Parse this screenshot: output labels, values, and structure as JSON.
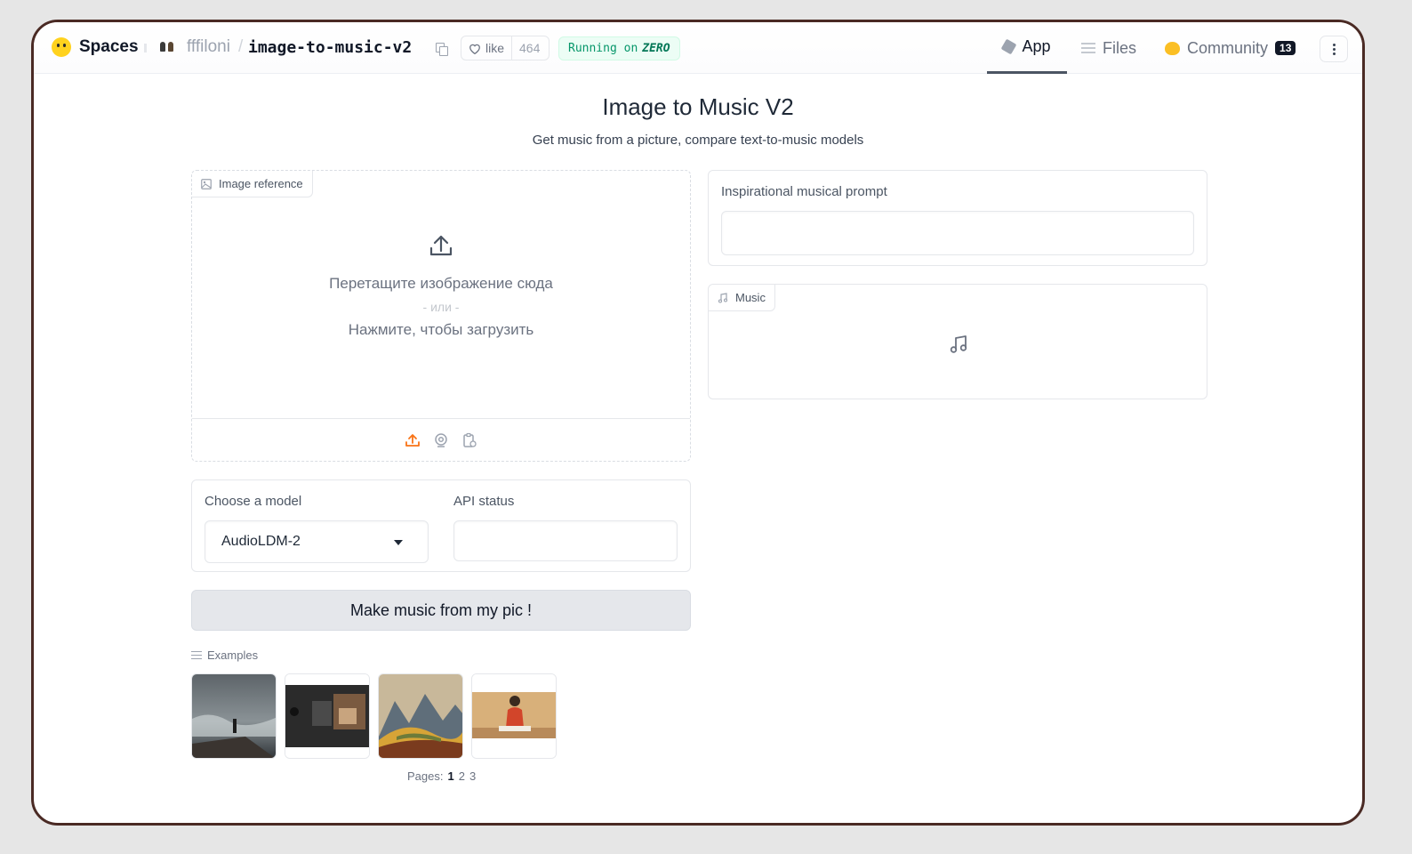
{
  "header": {
    "spaces_label": "Spaces",
    "owner": "fffiloni",
    "repo": "image-to-music-v2",
    "like_label": "like",
    "like_count": "464",
    "running_prefix": "Running on",
    "running_hw": "ZERO",
    "tabs": [
      {
        "label": "App",
        "icon": "cube-icon",
        "active": true
      },
      {
        "label": "Files",
        "icon": "files-icon",
        "active": false
      },
      {
        "label": "Community",
        "icon": "community-icon",
        "active": false,
        "badge": "13"
      }
    ]
  },
  "app": {
    "title": "Image to Music V2",
    "subtitle": "Get music from a picture, compare text-to-music models"
  },
  "image_input": {
    "label": "Image reference",
    "drop_text": "Перетащите изображение сюда",
    "or_text": "- или -",
    "click_text": "Нажмите, чтобы загрузить",
    "sources": [
      "upload-icon",
      "webcam-icon",
      "clipboard-icon"
    ]
  },
  "prompt_output": {
    "label": "Inspirational musical prompt",
    "value": ""
  },
  "music_output": {
    "label": "Music"
  },
  "model_select": {
    "label": "Choose a model",
    "value": "AudioLDM-2"
  },
  "api_status": {
    "label": "API status",
    "value": ""
  },
  "submit_button": {
    "label": "Make music from my pic !"
  },
  "examples": {
    "label": "Examples",
    "items": [
      {
        "name": "stormy-sea-cliff"
      },
      {
        "name": "vintage-car-interior"
      },
      {
        "name": "painted-hills"
      },
      {
        "name": "woman-at-table"
      }
    ],
    "pages_label": "Pages:",
    "pages": [
      "1",
      "2",
      "3"
    ],
    "current_page": "1"
  },
  "colors": {
    "accent": "#f97316",
    "running_green": "#059669",
    "frame_border": "#4a2a24"
  }
}
